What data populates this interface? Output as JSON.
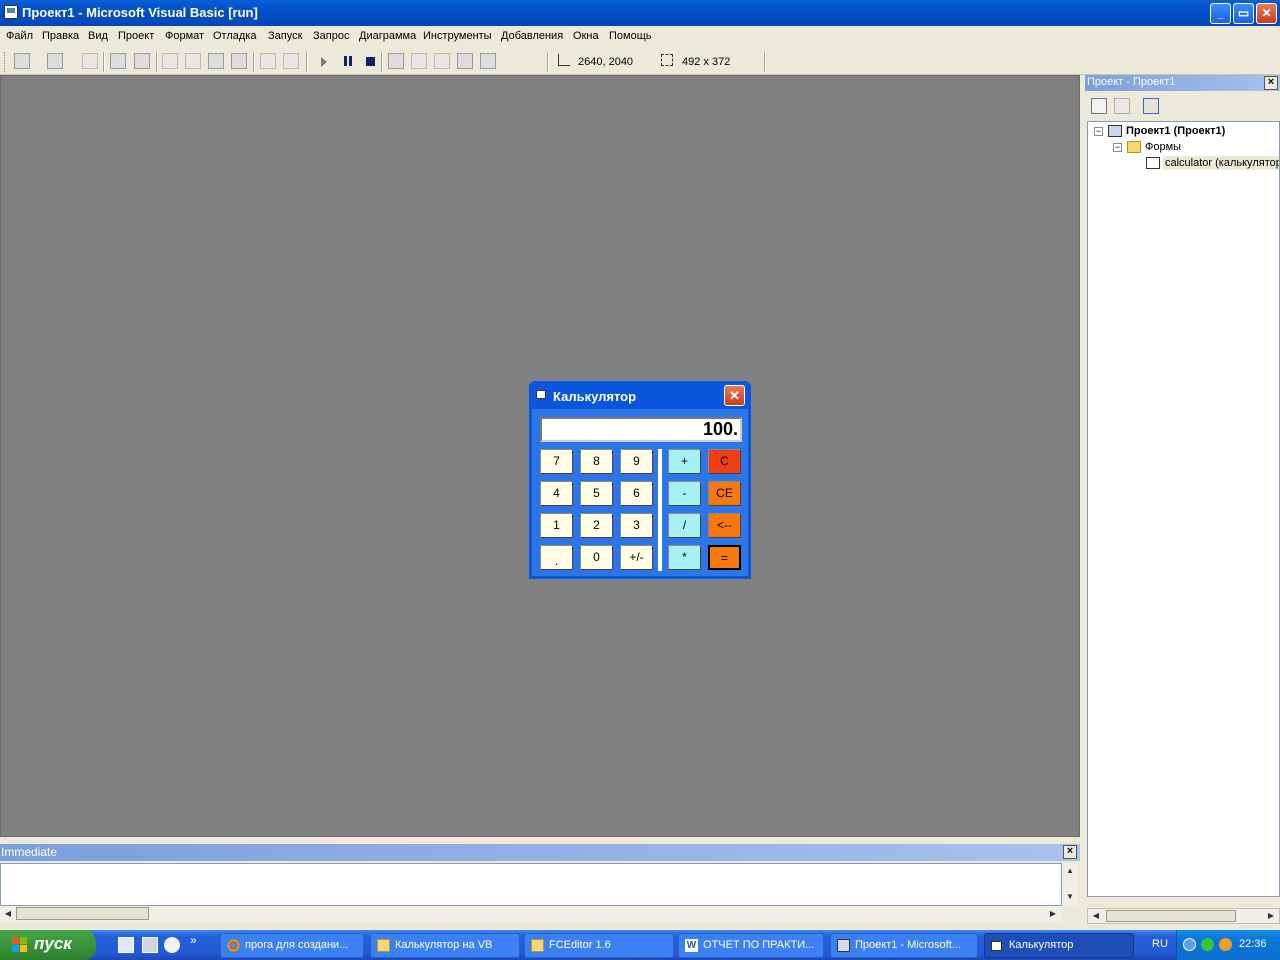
{
  "window": {
    "title": "Проект1 - Microsoft Visual Basic [run]",
    "controls": {
      "minimize": "_",
      "maximize": "▭",
      "close": "✕"
    }
  },
  "menu": [
    "Файл",
    "Правка",
    "Вид",
    "Проект",
    "Формат",
    "Отладка",
    "Запуск",
    "Запрос",
    "Диаграмма",
    "Инструменты",
    "Добавления",
    "Окна",
    "Помощь"
  ],
  "toolbar": {
    "position_readout": "2640, 2040",
    "size_readout": "492 x 372"
  },
  "project_panel": {
    "title": "Проект - Проект1",
    "close": "×",
    "tree": {
      "project": "Проект1 (Проект1)",
      "folder": "Формы",
      "form": "calculator (калькулятор)"
    }
  },
  "immediate": {
    "title": "Immediate",
    "close": "×",
    "text": ""
  },
  "calculator": {
    "title": "Калькулятор",
    "close": "✕",
    "display": "100.",
    "digit_rows": [
      [
        "7",
        "8",
        "9"
      ],
      [
        "4",
        "5",
        "6"
      ],
      [
        "1",
        "2",
        "3"
      ],
      [
        ".",
        "0",
        "+/-"
      ]
    ],
    "ops": [
      "+",
      "-",
      "/",
      "*"
    ],
    "controls": [
      "C",
      "CE",
      "<--",
      "="
    ]
  },
  "taskbar": {
    "start": "пуск",
    "quicklaunch_more": "»",
    "tasks": [
      {
        "label": "прога для создани...",
        "icon": "chrome-icon",
        "active": false
      },
      {
        "label": "Калькулятор на VB",
        "icon": "folder-icon",
        "active": false
      },
      {
        "label": "FCEditor 1.6",
        "icon": "folder-icon",
        "active": false
      },
      {
        "label": "ОТЧЕТ ПО ПРАКТИ...",
        "icon": "word-icon",
        "active": false
      },
      {
        "label": "Проект1 - Microsoft...",
        "icon": "vb-icon",
        "active": false
      },
      {
        "label": "Калькулятор",
        "icon": "form-icon",
        "active": true
      }
    ],
    "language": "RU",
    "time": "22:36"
  }
}
